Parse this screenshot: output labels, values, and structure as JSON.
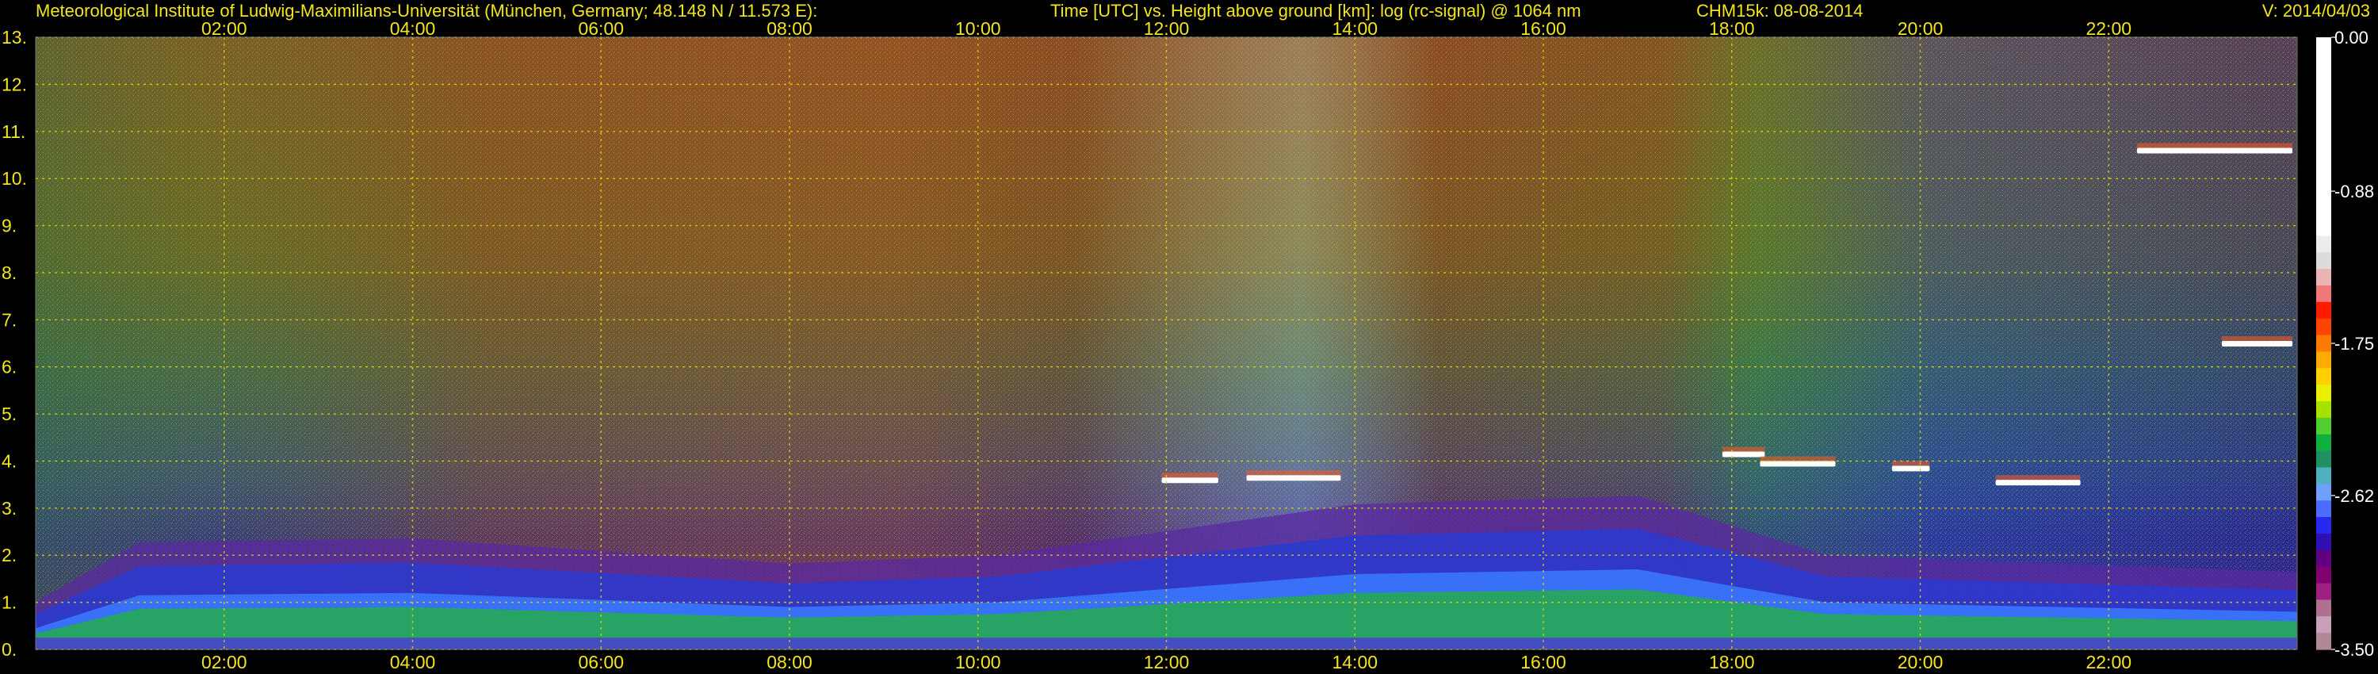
{
  "header": {
    "institute": "Meteorological Institute of Ludwig-Maximilians-Universität (München, Germany; 48.148 N / 11.573 E):",
    "title": "Time [UTC] vs. Height above ground [km]: log (rc-signal) @ 1064 nm",
    "instrument_date": "CHM15k: 08-08-2014",
    "version": "V: 2014/04/03"
  },
  "chart_data": {
    "type": "heatmap",
    "title": "Time [UTC] vs. Height above ground [km]: log (rc-signal) @ 1064 nm",
    "xlabel": "",
    "ylabel": "",
    "x_unit": "UTC",
    "y_unit": "km",
    "xlim": [
      "00:00",
      "24:00"
    ],
    "ylim": [
      0,
      13
    ],
    "grid": true,
    "x_ticks": [
      "02:00",
      "04:00",
      "06:00",
      "08:00",
      "10:00",
      "12:00",
      "14:00",
      "16:00",
      "18:00",
      "20:00",
      "22:00"
    ],
    "x_tick_hours": [
      2,
      4,
      6,
      8,
      10,
      12,
      14,
      16,
      18,
      20,
      22
    ],
    "y_ticks": [
      "0.",
      "1.",
      "2.",
      "3.",
      "4.",
      "5.",
      "6.",
      "7.",
      "8.",
      "9.",
      "10.",
      "11.",
      "12.",
      "13."
    ],
    "y_tick_values": [
      0,
      1,
      2,
      3,
      4,
      5,
      6,
      7,
      8,
      9,
      10,
      11,
      12,
      13
    ],
    "colorbar": {
      "range": [
        -3.5,
        0.0
      ],
      "tick_labels": [
        "0.00",
        "-0.88",
        "-1.75",
        "-2.62",
        "-3.50"
      ],
      "tick_values": [
        0.0,
        -0.88,
        -1.75,
        -2.62,
        -3.5
      ],
      "colors": [
        "#ffffff",
        "#ffffff",
        "#ffffff",
        "#ffffff",
        "#ffffff",
        "#ffffff",
        "#ffffff",
        "#ffffff",
        "#ffffff",
        "#ffffff",
        "#ffffff",
        "#ffffff",
        "#ececec",
        "#dcdcdc",
        "#eab4b4",
        "#f07878",
        "#ff1a00",
        "#ff4400",
        "#ff7a00",
        "#ffaa00",
        "#ffd000",
        "#e8f000",
        "#a8e000",
        "#50d030",
        "#10b040",
        "#209060",
        "#50b0c0",
        "#6fa0ff",
        "#4c6cff",
        "#2828f0",
        "#3010b0",
        "#600080",
        "#800070",
        "#a02080",
        "#b07090",
        "#c8a0b8",
        "#b08898"
      ]
    },
    "cloud_layers": [
      {
        "t_start": 11.95,
        "t_end": 12.55,
        "height_km": 3.6
      },
      {
        "t_start": 12.85,
        "t_end": 13.85,
        "height_km": 3.65
      },
      {
        "t_start": 17.9,
        "t_end": 18.35,
        "height_km": 4.15
      },
      {
        "t_start": 18.3,
        "t_end": 19.1,
        "height_km": 3.95
      },
      {
        "t_start": 19.7,
        "t_end": 20.1,
        "height_km": 3.85
      },
      {
        "t_start": 20.8,
        "t_end": 21.7,
        "height_km": 3.55
      },
      {
        "t_start": 22.3,
        "t_end": 23.95,
        "height_km": 10.6
      },
      {
        "t_start": 23.2,
        "t_end": 23.95,
        "height_km": 6.5
      }
    ],
    "boundary_layer_top_km": [
      {
        "t": 0.0,
        "h": 0.45
      },
      {
        "t": 1.1,
        "h": 1.15
      },
      {
        "t": 4.0,
        "h": 1.2
      },
      {
        "t": 8.0,
        "h": 0.9
      },
      {
        "t": 10.2,
        "h": 1.0
      },
      {
        "t": 14.0,
        "h": 1.6
      },
      {
        "t": 17.0,
        "h": 1.7
      },
      {
        "t": 19.0,
        "h": 1.0
      },
      {
        "t": 24.0,
        "h": 0.8
      }
    ]
  }
}
